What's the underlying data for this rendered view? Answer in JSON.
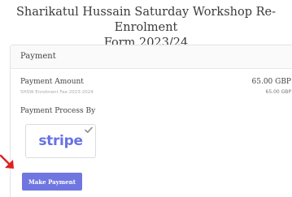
{
  "form": {
    "title_line1": "Sharikatul Hussain Saturday Workshop Re-Enrolment",
    "title_line2": "Form 2023/24"
  },
  "payment": {
    "header": "Payment",
    "amount_label": "Payment Amount",
    "amount_value": "65.00 GBP",
    "line_item_label": "SHSW Enrolment Fee 2023-2024",
    "line_item_value": "65.00 GBP",
    "process_label": "Payment Process By",
    "gateway": {
      "name": "stripe",
      "selected": true,
      "icon": "check-icon"
    },
    "pay_button_label": "Make Payment"
  },
  "annotation": {
    "icon": "arrow-icon",
    "color": "#e02020"
  },
  "colors": {
    "accent": "#6f76e0",
    "stripe_brand": "#6772e5"
  }
}
